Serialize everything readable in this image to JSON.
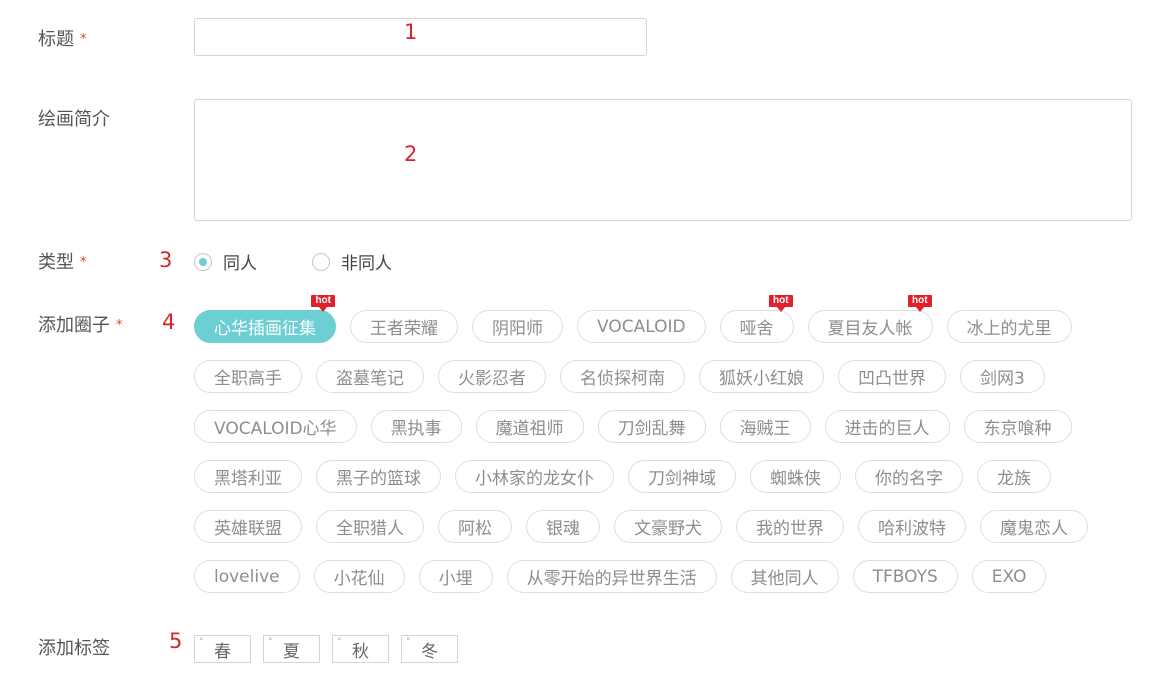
{
  "form": {
    "title_label": "标题",
    "required_mark": "*",
    "intro_label": "绘画简介",
    "type_label": "类型",
    "circle_label": "添加圈子",
    "tag_label": "添加标签"
  },
  "annotations": [
    "1",
    "2",
    "3",
    "4",
    "5"
  ],
  "type_options": [
    {
      "label": "同人",
      "checked": true
    },
    {
      "label": "非同人",
      "checked": false
    }
  ],
  "hot_badge": "hot",
  "accent_color": "#6ccfd3",
  "hot_color": "#e0212a",
  "circle_rows": [
    [
      "心华插画征集",
      "王者荣耀",
      "阴阳师",
      "VOCALOID",
      "哑舍",
      "夏目友人帐",
      "冰上的尤里"
    ],
    [
      "全职高手",
      "盗墓笔记",
      "火影忍者",
      "名侦探柯南",
      "狐妖小红娘",
      "凹凸世界",
      "剑网3"
    ],
    [
      "VOCALOID心华",
      "黑执事",
      "魔道祖师",
      "刀剑乱舞",
      "海贼王",
      "进击的巨人",
      "东京喰种"
    ],
    [
      "黑塔利亚",
      "黑子的篮球",
      "小林家的龙女仆",
      "刀剑神域",
      "蜘蛛侠",
      "你的名字",
      "龙族"
    ],
    [
      "英雄联盟",
      "全职猎人",
      "阿松",
      "银魂",
      "文豪野犬",
      "我的世界",
      "哈利波特",
      "魔鬼恋人"
    ],
    [
      "lovelive",
      "小花仙",
      "小埋",
      "从零开始的异世界生活",
      "其他同人",
      "TFBOYS",
      "EXO"
    ]
  ],
  "circle_active": "心华插画征集",
  "circle_hot": [
    "心华插画征集",
    "哑舍",
    "夏目友人帐"
  ],
  "season_tags": [
    "春",
    "夏",
    "秋",
    "冬"
  ],
  "season_mark": "°"
}
